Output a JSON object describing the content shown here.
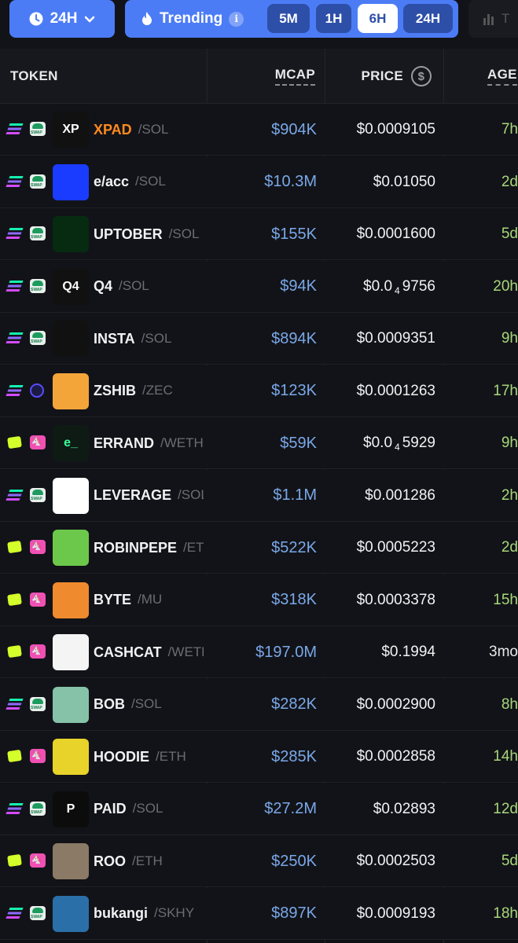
{
  "topbar": {
    "period_label": "24H",
    "trending_label": "Trending",
    "timeframes": [
      "5M",
      "1H",
      "6H",
      "24H"
    ],
    "active_timeframe": "6H",
    "extra_tab_label": "T"
  },
  "table": {
    "headers": {
      "token": "TOKEN",
      "mcap": "MCAP",
      "price": "PRICE",
      "age": "AGE"
    },
    "rows": [
      {
        "symbol": "XPAD",
        "pair": "/SOL",
        "chain": "sol",
        "dex": "swap",
        "mcap": "$904K",
        "price": "$0.0009105",
        "age": "7h",
        "logo_text": "XP",
        "logo_bg": "#111111",
        "logo_fg": "#ffffff",
        "highlight": true
      },
      {
        "symbol": "e/acc",
        "pair": "/SOL",
        "chain": "sol",
        "dex": "swap",
        "mcap": "$10.3M",
        "price": "$0.01050",
        "age": "2d",
        "logo_text": "",
        "logo_bg": "#1a3cff",
        "logo_fg": "#ffffff"
      },
      {
        "symbol": "UPTOBER",
        "pair": "/SOL",
        "chain": "sol",
        "dex": "swap",
        "mcap": "$155K",
        "price": "$0.0001600",
        "age": "5d",
        "logo_text": "",
        "logo_bg": "#062b10",
        "logo_fg": "#22ff44"
      },
      {
        "symbol": "Q4",
        "pair": "/SOL",
        "chain": "sol",
        "dex": "swap",
        "mcap": "$94K",
        "price_main": "$0.0",
        "price_sub": "4",
        "price_rest": "9756",
        "age": "20h",
        "logo_text": "Q4",
        "logo_bg": "#111111",
        "logo_fg": "#ffffff"
      },
      {
        "symbol": "INSTA",
        "pair": "/SOL",
        "chain": "sol",
        "dex": "swap",
        "mcap": "$894K",
        "price": "$0.0009351",
        "age": "9h",
        "logo_text": "",
        "logo_bg": "#111111",
        "logo_fg": "#ffffff"
      },
      {
        "symbol": "ZSHIB",
        "pair": "/ZEC",
        "chain": "zec",
        "dex": "ray",
        "mcap": "$123K",
        "price": "$0.0001263",
        "age": "17h",
        "logo_text": "",
        "logo_bg": "#f3a53a",
        "logo_fg": "#ffffff"
      },
      {
        "symbol": "ERRAND",
        "pair": "/WETH",
        "chain": "base",
        "dex": "uni",
        "mcap": "$59K",
        "price_main": "$0.0",
        "price_sub": "4",
        "price_rest": "5929",
        "age": "9h",
        "logo_text": "e_",
        "logo_bg": "#0e1a14",
        "logo_fg": "#3cff9a"
      },
      {
        "symbol": "LEVERAGE",
        "pair": "/SOL",
        "chain": "sol",
        "dex": "swap",
        "mcap": "$1.1M",
        "price": "$0.001286",
        "age": "2h",
        "logo_text": "",
        "logo_bg": "#ffffff",
        "logo_fg": "#111111"
      },
      {
        "symbol": "ROBINPEPE",
        "pair": "/ETH",
        "chain": "base",
        "dex": "uni",
        "mcap": "$522K",
        "price": "$0.0005223",
        "age": "2d",
        "logo_text": "",
        "logo_bg": "#6cc84a",
        "logo_fg": "#ffffff"
      },
      {
        "symbol": "BYTE",
        "pair": "/MU",
        "chain": "base",
        "dex": "uni",
        "mcap": "$318K",
        "price": "$0.0003378",
        "age": "15h",
        "logo_text": "",
        "logo_bg": "#f08a2e",
        "logo_fg": "#ffffff"
      },
      {
        "symbol": "CASHCAT",
        "pair": "/WETH",
        "chain": "base",
        "dex": "uni",
        "mcap": "$197.0M",
        "price": "$0.1994",
        "age": "3mo",
        "logo_text": "",
        "logo_bg": "#f4f4f4",
        "logo_fg": "#111111",
        "age_white": true
      },
      {
        "symbol": "BOB",
        "pair": "/SOL",
        "chain": "sol",
        "dex": "swap",
        "mcap": "$282K",
        "price": "$0.0002900",
        "age": "8h",
        "logo_text": "",
        "logo_bg": "#86c2a8",
        "logo_fg": "#ffffff"
      },
      {
        "symbol": "HOODIE",
        "pair": "/ETH",
        "chain": "base",
        "dex": "uni",
        "mcap": "$285K",
        "price": "$0.0002858",
        "age": "14h",
        "logo_text": "",
        "logo_bg": "#e7d32a",
        "logo_fg": "#111111"
      },
      {
        "symbol": "PAID",
        "pair": "/SOL",
        "chain": "sol",
        "dex": "swap",
        "mcap": "$27.2M",
        "price": "$0.02893",
        "age": "12d",
        "logo_text": "P",
        "logo_bg": "#0c0c0c",
        "logo_fg": "#ffffff"
      },
      {
        "symbol": "ROO",
        "pair": "/ETH",
        "chain": "base",
        "dex": "uni",
        "mcap": "$250K",
        "price": "$0.0002503",
        "age": "5d",
        "logo_text": "",
        "logo_bg": "#8a7a66",
        "logo_fg": "#ffffff"
      },
      {
        "symbol": "bukangi",
        "pair": "/SKHY",
        "chain": "sol",
        "dex": "swap",
        "mcap": "$897K",
        "price": "$0.0009193",
        "age": "18h",
        "logo_text": "",
        "logo_bg": "#2b6fa8",
        "logo_fg": "#ffffff"
      }
    ]
  }
}
